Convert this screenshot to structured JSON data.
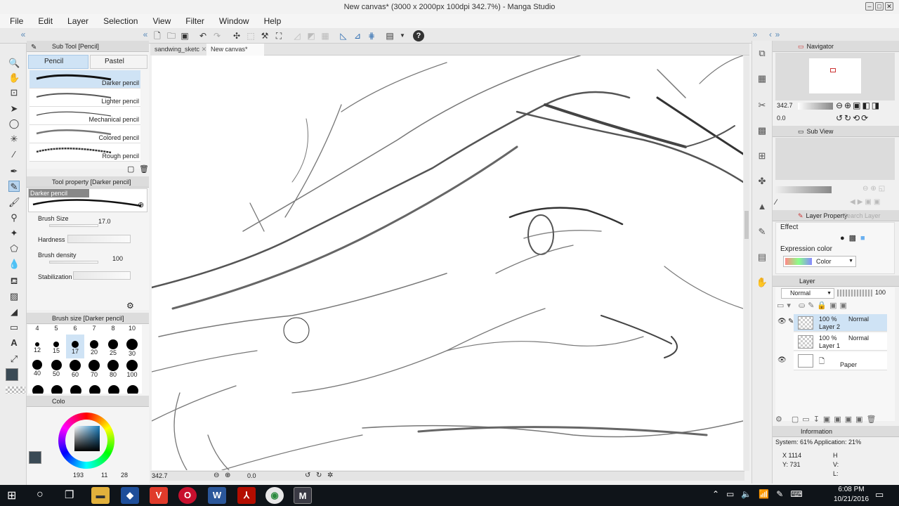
{
  "window": {
    "title": "New canvas* (3000 x 2000px 100dpi 342.7%) - Manga Studio"
  },
  "menu": [
    "File",
    "Edit",
    "Layer",
    "Selection",
    "View",
    "Filter",
    "Window",
    "Help"
  ],
  "subtool": {
    "header": "Sub Tool [Pencil]",
    "tabs": [
      "Pencil",
      "Pastel"
    ],
    "brushes": [
      "Darker pencil",
      "Lighter pencil",
      "Mechanical pencil",
      "Colored pencil",
      "Rough pencil"
    ]
  },
  "toolprop": {
    "header": "Tool property [Darker pencil]",
    "preview_name": "Darker pencil",
    "brush_size_label": "Brush Size",
    "brush_size_value": "17.0",
    "hardness_label": "Hardness",
    "density_label": "Brush density",
    "density_value": "100",
    "stabilization_label": "Stabilization"
  },
  "brushsize": {
    "header": "Brush size [Darker pencil]",
    "top_labels": [
      "4",
      "5",
      "6",
      "7",
      "8",
      "10"
    ],
    "row1": [
      "12",
      "15",
      "17",
      "20",
      "25",
      "30"
    ],
    "row2": [
      "40",
      "50",
      "60",
      "70",
      "80",
      "100"
    ]
  },
  "color": {
    "tab_label": "Colo",
    "readout": [
      "193",
      "11",
      "28"
    ],
    "main": "#3a4a55"
  },
  "tabs": [
    "sandwing_sketc",
    "New canvas*"
  ],
  "canvas_status": {
    "zoom": "342.7",
    "angle": "0.0"
  },
  "navigator": {
    "header": "Navigator",
    "zoom": "342.7",
    "angle": "0.0"
  },
  "subview": {
    "header": "Sub View"
  },
  "layerprop": {
    "header": "Layer Property",
    "search": "Search Layer",
    "effect": "Effect",
    "expr_label": "Expression color",
    "expr_value": "Color"
  },
  "layers": {
    "header": "Layer",
    "blend": "Normal",
    "opacity": "100",
    "items": [
      {
        "opacity": "100 %",
        "mode": "Normal",
        "name": "Layer 2"
      },
      {
        "opacity": "100 %",
        "mode": "Normal",
        "name": "Layer 1"
      },
      {
        "opacity": "",
        "mode": "",
        "name": "Paper"
      }
    ]
  },
  "info": {
    "header": "Information",
    "system": "System: 61%  Application: 21%",
    "x": "X  1114",
    "y": "Y: 731",
    "h": "H",
    "v": "V:",
    "l": "L:"
  },
  "taskbar": {
    "time": "6:08 PM",
    "date": "10/21/2016"
  }
}
